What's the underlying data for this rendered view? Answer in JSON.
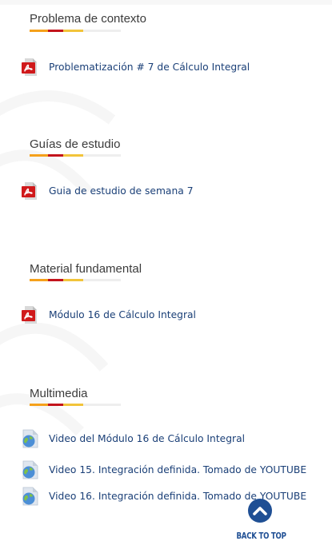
{
  "sections": [
    {
      "title": "Problema de contexto",
      "items": [
        {
          "label": "Problematización # 7 de Cálculo Integral",
          "icon": "pdf-icon"
        }
      ]
    },
    {
      "title": "Guías de estudio",
      "items": [
        {
          "label": "Guia de estudio de semana 7",
          "icon": "pdf-icon"
        }
      ]
    },
    {
      "title": "Material fundamental",
      "items": [
        {
          "label": "Módulo 16 de Cálculo Integral",
          "icon": "pdf-icon"
        }
      ]
    },
    {
      "title": "Multimedia",
      "items": [
        {
          "label": "Video del Módulo 16 de Cálculo Integral",
          "icon": "web-link-icon"
        },
        {
          "label": "Video 15. Integración definida. Tomado de YOUTUBE",
          "icon": "web-link-icon"
        },
        {
          "label": "Video 16. Integración definida. Tomado de YOUTUBE",
          "icon": "web-link-icon"
        }
      ]
    }
  ],
  "back_to_top": {
    "label": "BACK TO TOP",
    "icon": "chevron-up-icon"
  },
  "colors": {
    "link": "#1a3f77",
    "title": "#3b3b3b",
    "accent_orange": "#f5a11b",
    "accent_red": "#c3141c",
    "accent_yellow": "#f2c43a",
    "back_to_top": "#1f4f94"
  }
}
